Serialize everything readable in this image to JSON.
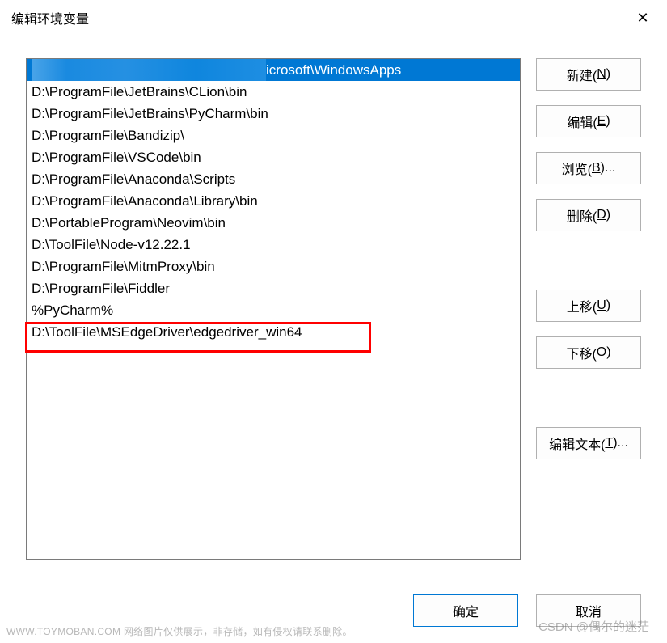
{
  "dialog": {
    "title": "编辑环境变量"
  },
  "list": {
    "items": [
      {
        "text_prefix": "",
        "text_suffix": "icrosoft\\WindowsApps",
        "selected": true,
        "blurred": true,
        "highlighted": false
      },
      {
        "text": "D:\\ProgramFile\\JetBrains\\CLion\\bin",
        "selected": false,
        "highlighted": false
      },
      {
        "text": "D:\\ProgramFile\\JetBrains\\PyCharm\\bin",
        "selected": false,
        "highlighted": false
      },
      {
        "text": "D:\\ProgramFile\\Bandizip\\",
        "selected": false,
        "highlighted": false
      },
      {
        "text": "D:\\ProgramFile\\VSCode\\bin",
        "selected": false,
        "highlighted": false
      },
      {
        "text": "D:\\ProgramFile\\Anaconda\\Scripts",
        "selected": false,
        "highlighted": false
      },
      {
        "text": "D:\\ProgramFile\\Anaconda\\Library\\bin",
        "selected": false,
        "highlighted": false
      },
      {
        "text": "D:\\PortableProgram\\Neovim\\bin",
        "selected": false,
        "highlighted": false
      },
      {
        "text": "D:\\ToolFile\\Node-v12.22.1",
        "selected": false,
        "highlighted": false
      },
      {
        "text": "D:\\ProgramFile\\MitmProxy\\bin",
        "selected": false,
        "highlighted": false
      },
      {
        "text": "D:\\ProgramFile\\Fiddler",
        "selected": false,
        "highlighted": false
      },
      {
        "text": "%PyCharm%",
        "selected": false,
        "highlighted": false
      },
      {
        "text": "D:\\ToolFile\\MSEdgeDriver\\edgedriver_win64",
        "selected": false,
        "highlighted": true
      }
    ]
  },
  "buttons": {
    "new": "新建(N)",
    "new_key": "N",
    "edit": "编辑(E)",
    "edit_key": "E",
    "browse": "浏览(B)...",
    "browse_key": "B",
    "delete": "删除(D)",
    "delete_key": "D",
    "moveup": "上移(U)",
    "moveup_key": "U",
    "movedown": "下移(O)",
    "movedown_key": "O",
    "edittext": "编辑文本(T)...",
    "edittext_key": "T",
    "ok": "确定",
    "cancel": "取消"
  },
  "watermark": {
    "left": "WWW.TOYMOBAN.COM 网络图片仅供展示，非存储，如有侵权请联系删除。",
    "right": "CSDN @偶尔的迷茫"
  }
}
